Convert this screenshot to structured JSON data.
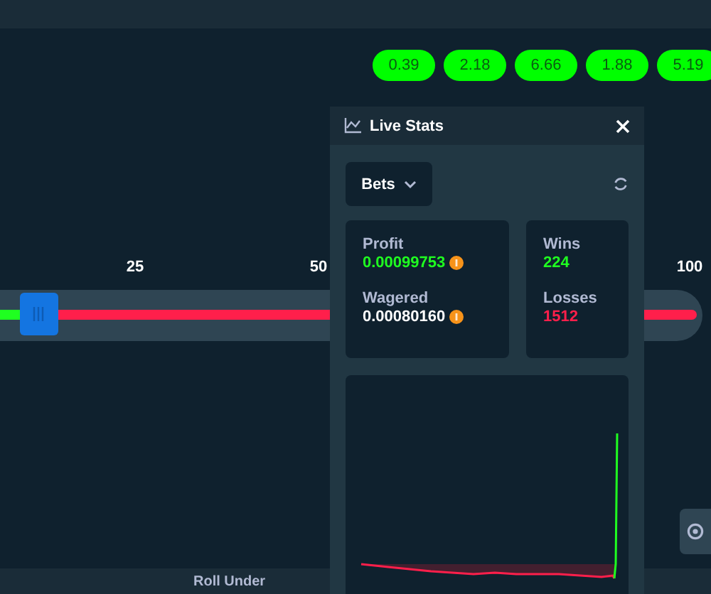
{
  "recent_results": [
    {
      "value": "0.39"
    },
    {
      "value": "2.18"
    },
    {
      "value": "6.66"
    },
    {
      "value": "1.88"
    },
    {
      "value": "5.19"
    }
  ],
  "slider": {
    "level": 0.055,
    "ticks": [
      {
        "label": "25"
      },
      {
        "label": "50"
      },
      {
        "label": "100"
      }
    ]
  },
  "live_stats": {
    "title": "Live Stats",
    "filter": "Bets",
    "profit": {
      "label": "Profit",
      "value": "0.00099753"
    },
    "wagered": {
      "label": "Wagered",
      "value": "0.00080160"
    },
    "wins": {
      "label": "Wins",
      "value": "224"
    },
    "losses": {
      "label": "Losses",
      "value": "1512"
    }
  },
  "bottom_label": "Roll Under"
}
